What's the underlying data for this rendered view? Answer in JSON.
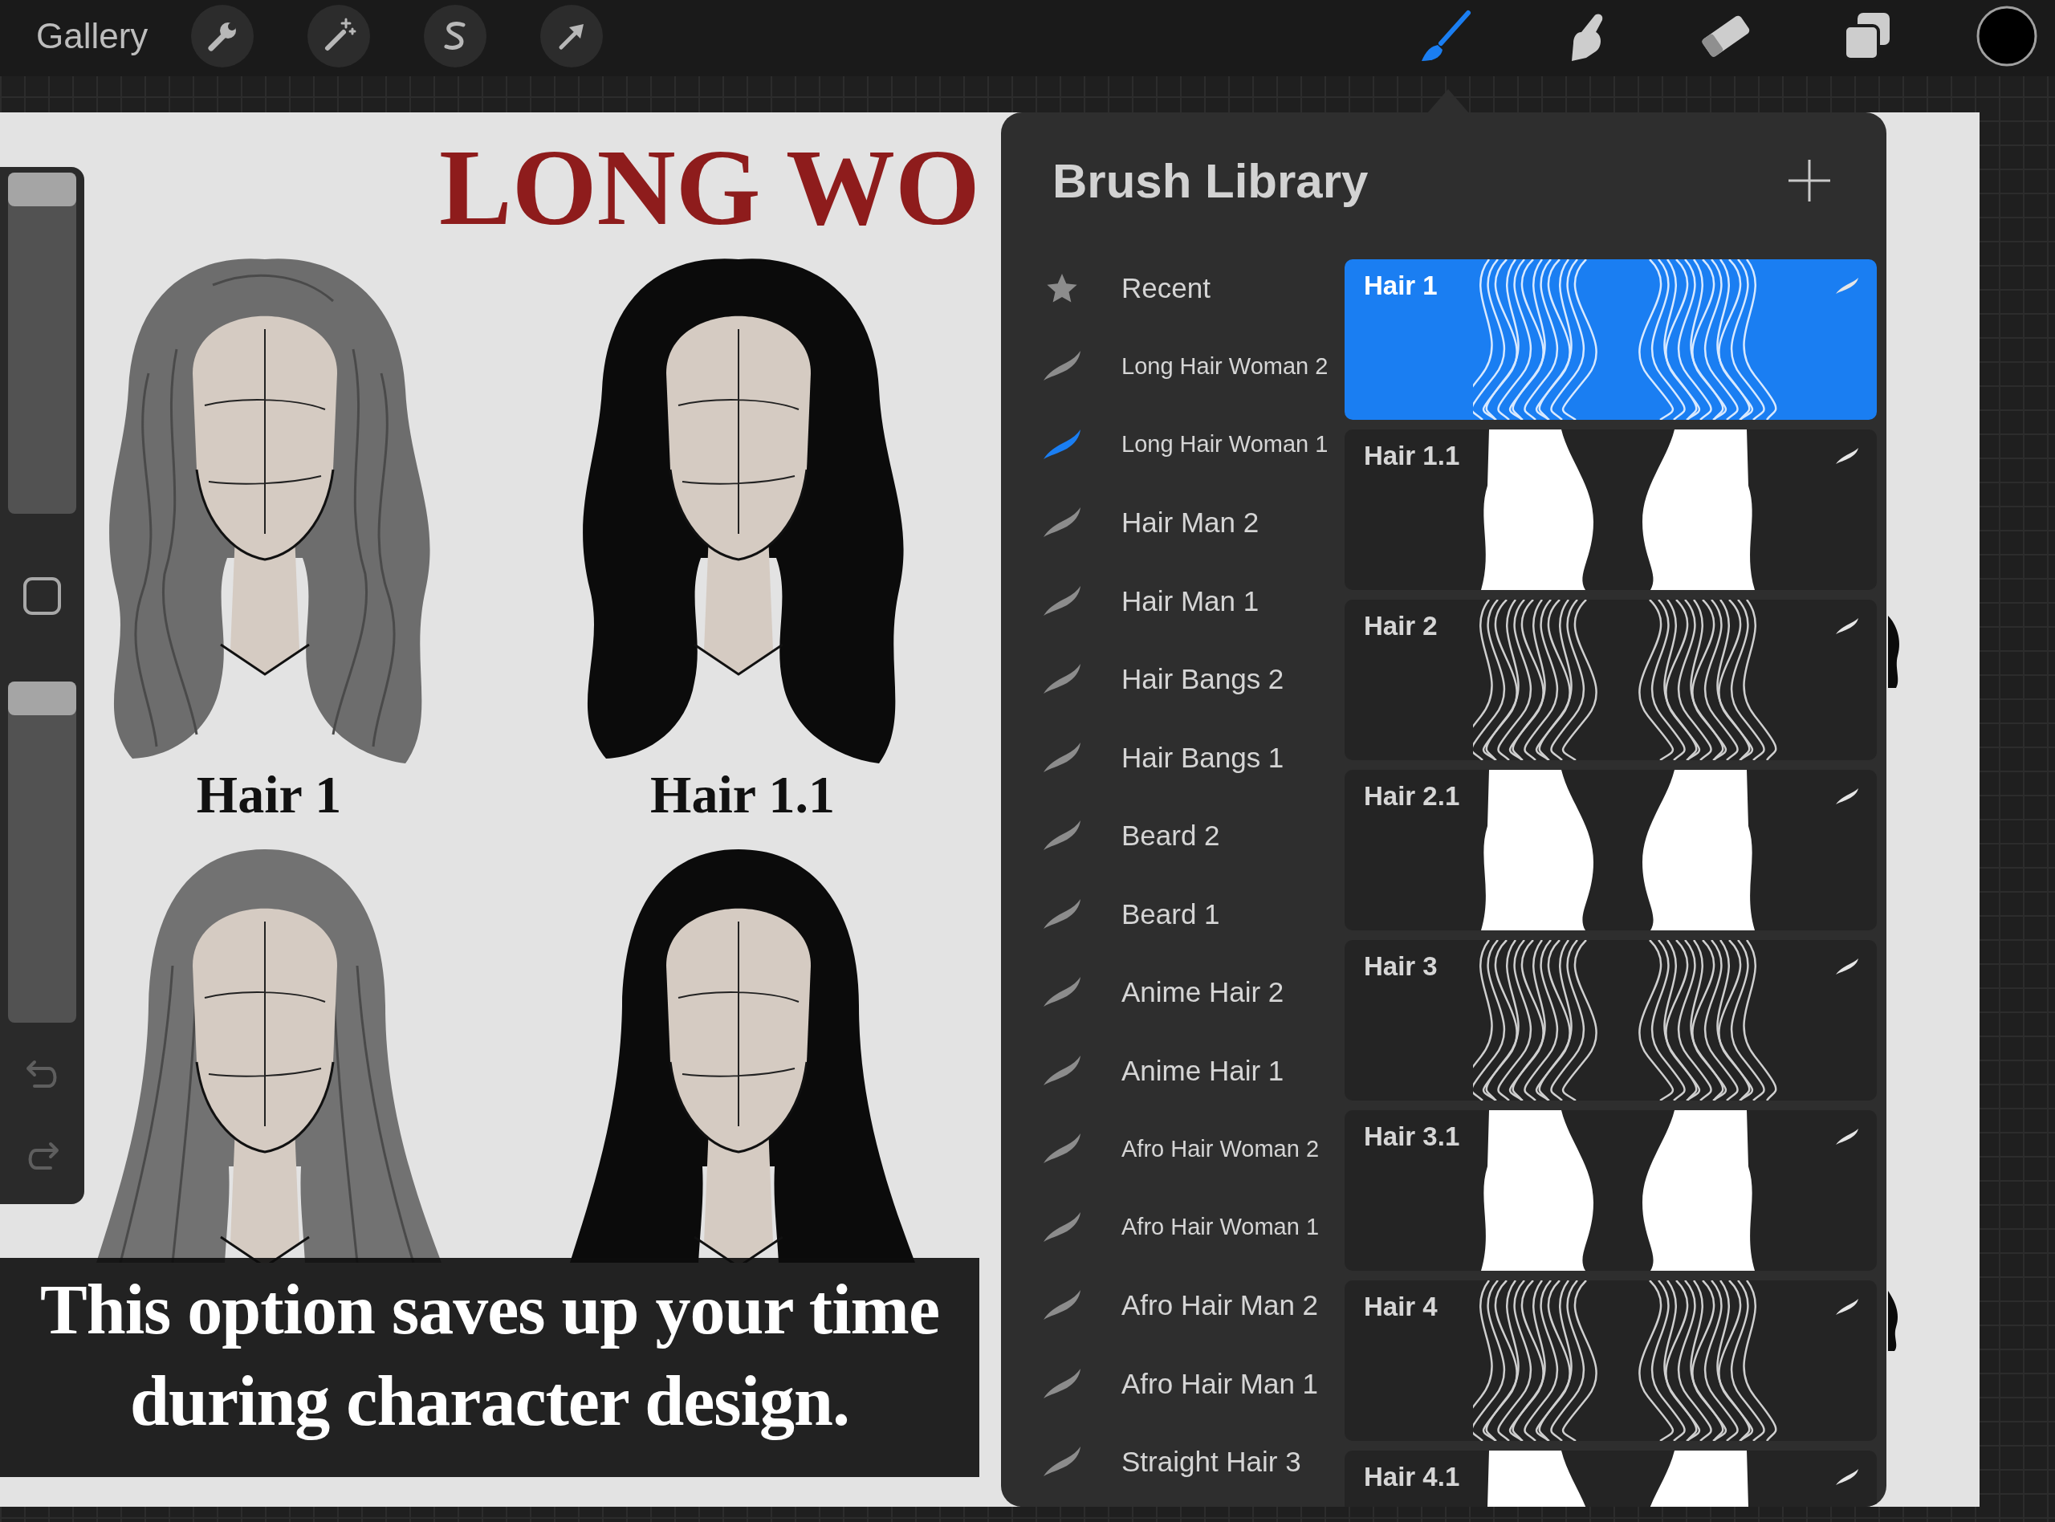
{
  "toolbar": {
    "gallery": "Gallery",
    "tools": [
      {
        "kind": "paint",
        "selected": true
      },
      {
        "kind": "smudge",
        "selected": false
      },
      {
        "kind": "erase",
        "selected": false
      },
      {
        "kind": "layers",
        "selected": false
      }
    ]
  },
  "sidebar": {
    "sliders": [
      {
        "level": 1
      },
      {
        "level": 1
      }
    ]
  },
  "canvas": {
    "title": "LONG WO",
    "labels": [
      "Hair 1",
      "Hair 1.1"
    ]
  },
  "brush_library": {
    "title": "Brush Library",
    "brush_sets": [
      {
        "kind": "recent",
        "name": "Recent",
        "selected": false
      },
      {
        "kind": "set",
        "name": "Long Hair Woman 2",
        "selected": false
      },
      {
        "kind": "set",
        "name": "Long Hair Woman 1",
        "selected": true
      },
      {
        "kind": "set",
        "name": "Hair Man 2",
        "selected": false
      },
      {
        "kind": "set",
        "name": "Hair Man 1",
        "selected": false
      },
      {
        "kind": "set",
        "name": "Hair Bangs 2",
        "selected": false
      },
      {
        "kind": "set",
        "name": "Hair Bangs 1",
        "selected": false
      },
      {
        "kind": "set",
        "name": "Beard 2",
        "selected": false
      },
      {
        "kind": "set",
        "name": "Beard 1",
        "selected": false
      },
      {
        "kind": "set",
        "name": "Anime Hair 2",
        "selected": false
      },
      {
        "kind": "set",
        "name": "Anime Hair 1",
        "selected": false
      },
      {
        "kind": "set",
        "name": "Afro Hair Woman 2",
        "selected": false
      },
      {
        "kind": "set",
        "name": "Afro Hair Woman 1",
        "selected": false
      },
      {
        "kind": "set",
        "name": "Afro Hair Man 2",
        "selected": false
      },
      {
        "kind": "set",
        "name": "Afro Hair Man 1",
        "selected": false
      },
      {
        "kind": "set",
        "name": "Straight Hair 3",
        "selected": false
      }
    ],
    "brushes": [
      {
        "name": "Hair 1",
        "kind": "strands",
        "selected": true
      },
      {
        "name": "Hair 1.1",
        "kind": "silhouette",
        "selected": false
      },
      {
        "name": "Hair 2",
        "kind": "strands",
        "selected": false
      },
      {
        "name": "Hair 2.1",
        "kind": "silhouette",
        "selected": false
      },
      {
        "name": "Hair 3",
        "kind": "strands",
        "selected": false
      },
      {
        "name": "Hair 3.1",
        "kind": "silhouette",
        "selected": false
      },
      {
        "name": "Hair 4",
        "kind": "strands",
        "selected": false
      },
      {
        "name": "Hair 4.1",
        "kind": "silhouette",
        "selected": false
      }
    ]
  },
  "caption": "This option saves up your time during character design."
}
